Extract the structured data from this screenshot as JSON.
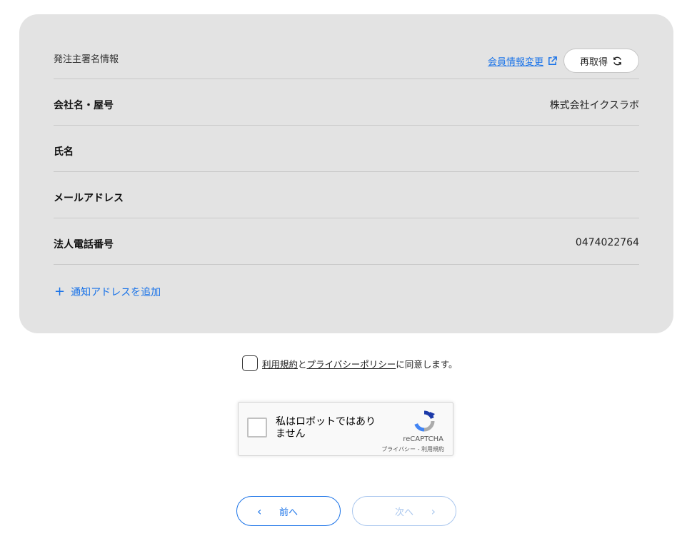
{
  "card": {
    "section_label": "発注主署名情報",
    "member_link_label": "会員情報変更",
    "refetch_label": "再取得",
    "rows": [
      {
        "label": "会社名・屋号",
        "value": "株式会社イクスラボ"
      },
      {
        "label": "氏名",
        "value": ""
      },
      {
        "label": "メールアドレス",
        "value": ""
      },
      {
        "label": "法人電話番号",
        "value": "0474022764"
      }
    ],
    "add_address_label": "通知アドレスを追加"
  },
  "consent": {
    "terms_link": "利用規約",
    "conjunction": "と",
    "privacy_link": "プライバシーポリシー",
    "suffix": "に同意します。"
  },
  "recaptcha": {
    "label": "私はロボットではありません",
    "brand": "reCAPTCHA",
    "terms": "プライバシー - 利用規約"
  },
  "navigation": {
    "prev_label": "前へ",
    "next_label": "次へ"
  },
  "colors": {
    "accent": "#1a73e8",
    "card_bg": "#e3e3e3",
    "disabled": "#aac7ee"
  },
  "icons": {
    "external_link": "external-link-icon",
    "refresh": "refresh-icon",
    "plus": "plus-icon",
    "chevron_left": "chevron-left-icon",
    "chevron_right": "chevron-right-icon",
    "recaptcha_logo": "recaptcha-logo-icon"
  }
}
